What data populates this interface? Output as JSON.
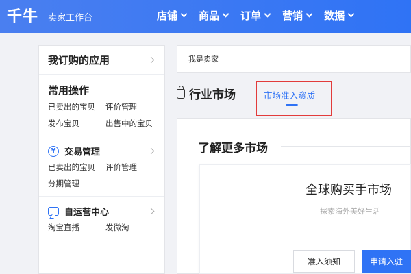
{
  "header": {
    "logo": "千牛",
    "subtitle": "卖家工作台",
    "nav": [
      "店铺",
      "商品",
      "订单",
      "营销",
      "数据"
    ]
  },
  "sidebar": {
    "head": "我订购的应用",
    "common": {
      "title": "常用操作",
      "links": [
        "已卖出的宝贝",
        "评价管理",
        "发布宝贝",
        "出售中的宝贝"
      ]
    },
    "trade": {
      "title": "交易管理",
      "icon": "yen-circle-icon",
      "links": [
        "已卖出的宝贝",
        "评价管理",
        "分期管理"
      ]
    },
    "self_ops": {
      "title": "自运营中心",
      "icon": "chat-bubble-icon",
      "links": [
        "淘宝直播",
        "发微淘"
      ]
    }
  },
  "breadcrumb": "我是卖家",
  "page": {
    "title": "行业市场",
    "active_tab": "市场准入资质"
  },
  "content": {
    "section_title": "了解更多市场",
    "market": {
      "title": "全球购买手市场",
      "subtitle": "探索海外美好生活",
      "notice_button": "准入须知",
      "apply_button": "申请入驻"
    }
  },
  "colors": {
    "accent": "#2f73f5",
    "highlight_border": "#e23b3b"
  }
}
